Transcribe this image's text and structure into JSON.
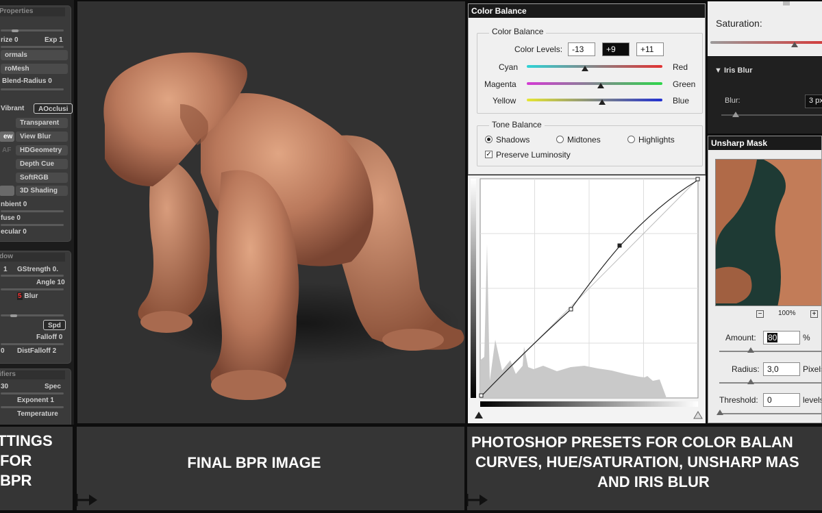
{
  "zbrush": {
    "group_properties_title": "Properties",
    "rasterize": "rize 0",
    "exp": "Exp 1",
    "normals": "ormals",
    "geomesh": "roMesh",
    "blend_radius": "Blend-Radius 0",
    "vibrant": "Vibrant",
    "aocclusion": "AOcclusi",
    "transparent": "Transparent",
    "view_left": "ew",
    "view_blur": "View Blur",
    "af": "AF",
    "hdgeometry": "HDGeometry",
    "depth_cue": "Depth Cue",
    "softrgb": "SoftRGB",
    "shading_3d": "3D Shading",
    "ambient": "nbient 0",
    "diffuse": "fuse 0",
    "specular": "ecular 0",
    "group_shadow_title": "dow",
    "shadow_left": "1",
    "gstrength": "GStrength 0.",
    "angle": "Angle 10",
    "blur_value": "5",
    "blur_label": "Blur",
    "spd": "Spd",
    "falloff": "Falloff 0",
    "dist_left": "0",
    "dist_falloff": "DistFalloff 2",
    "group_modifiers_title": "ifiers",
    "spec_left": "30",
    "spec": "Spec",
    "exponent": "Exponent 1",
    "temperature": "Temperature"
  },
  "color_balance": {
    "title": "Color Balance",
    "section_title": "Color Balance",
    "levels_label": "Color Levels:",
    "levels": [
      "-13",
      "+9",
      "+11"
    ],
    "sliders": [
      {
        "left": "Cyan",
        "right": "Red",
        "value": -13
      },
      {
        "left": "Magenta",
        "right": "Green",
        "value": 9
      },
      {
        "left": "Yellow",
        "right": "Blue",
        "value": 11
      }
    ],
    "tone_title": "Tone Balance",
    "tones": [
      "Shadows",
      "Midtones",
      "Highlights"
    ],
    "selected_tone": "Shadows",
    "preserve": "Preserve Luminosity",
    "preserve_checked": true
  },
  "saturation": {
    "label": "Saturation:"
  },
  "iris_blur": {
    "title": "Iris Blur",
    "blur_label": "Blur:",
    "blur_value": "3 px"
  },
  "unsharp": {
    "title": "Unsharp Mask",
    "zoom": "100%",
    "zoom_out": "−",
    "zoom_in": "+",
    "amount_label": "Amount:",
    "amount": "80",
    "amount_unit": "%",
    "radius_label": "Radius:",
    "radius": "3,0",
    "radius_unit": "Pixels",
    "threshold_label": "Threshold:",
    "threshold": "0",
    "threshold_unit": "levels"
  },
  "captions": {
    "left": [
      "TTINGS",
      "FOR",
      "BPR"
    ],
    "middle": "FINAL BPR IMAGE",
    "right": [
      "PHOTOSHOP PRESETS FOR COLOR BALAN",
      "CURVES, HUE/SATURATION, UNSHARP MAS",
      "AND IRIS BLUR"
    ]
  },
  "colors": {
    "render_bg": "#313131",
    "figure_skin": "#c07f63",
    "caption_bg": "#353535",
    "saturation_track": "#d43a3a"
  }
}
